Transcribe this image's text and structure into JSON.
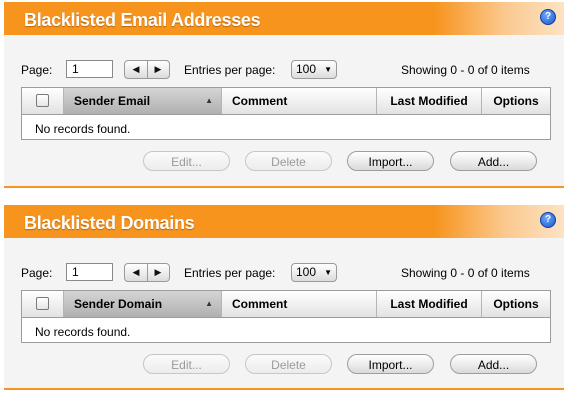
{
  "panels": [
    {
      "title": "Blacklisted Email Addresses",
      "page_label": "Page:",
      "page_value": "1",
      "prev_glyph": "◀",
      "next_glyph": "▶",
      "entries_label": "Entries per page:",
      "entries_value": "100",
      "showing": "Showing 0 - 0 of 0 items",
      "columns": [
        "Sender Email",
        "Comment",
        "Last Modified",
        "Options"
      ],
      "empty": "No records found.",
      "buttons": {
        "edit": "Edit...",
        "delete": "Delete",
        "import": "Import...",
        "add": "Add..."
      }
    },
    {
      "title": "Blacklisted Domains",
      "page_label": "Page:",
      "page_value": "1",
      "prev_glyph": "◀",
      "next_glyph": "▶",
      "entries_label": "Entries per page:",
      "entries_value": "100",
      "showing": "Showing 0 - 0 of 0 items",
      "columns": [
        "Sender Domain",
        "Comment",
        "Last Modified",
        "Options"
      ],
      "empty": "No records found.",
      "buttons": {
        "edit": "Edit...",
        "delete": "Delete",
        "import": "Import...",
        "add": "Add..."
      }
    }
  ],
  "icons": {
    "help": "help-icon",
    "sort": "sort-ascending-icon",
    "dropdown": "chevron-down-icon"
  },
  "colors": {
    "accent": "#f7941d",
    "panel_bg": "#f4f4f4",
    "help_blue": "#1a56c8"
  }
}
